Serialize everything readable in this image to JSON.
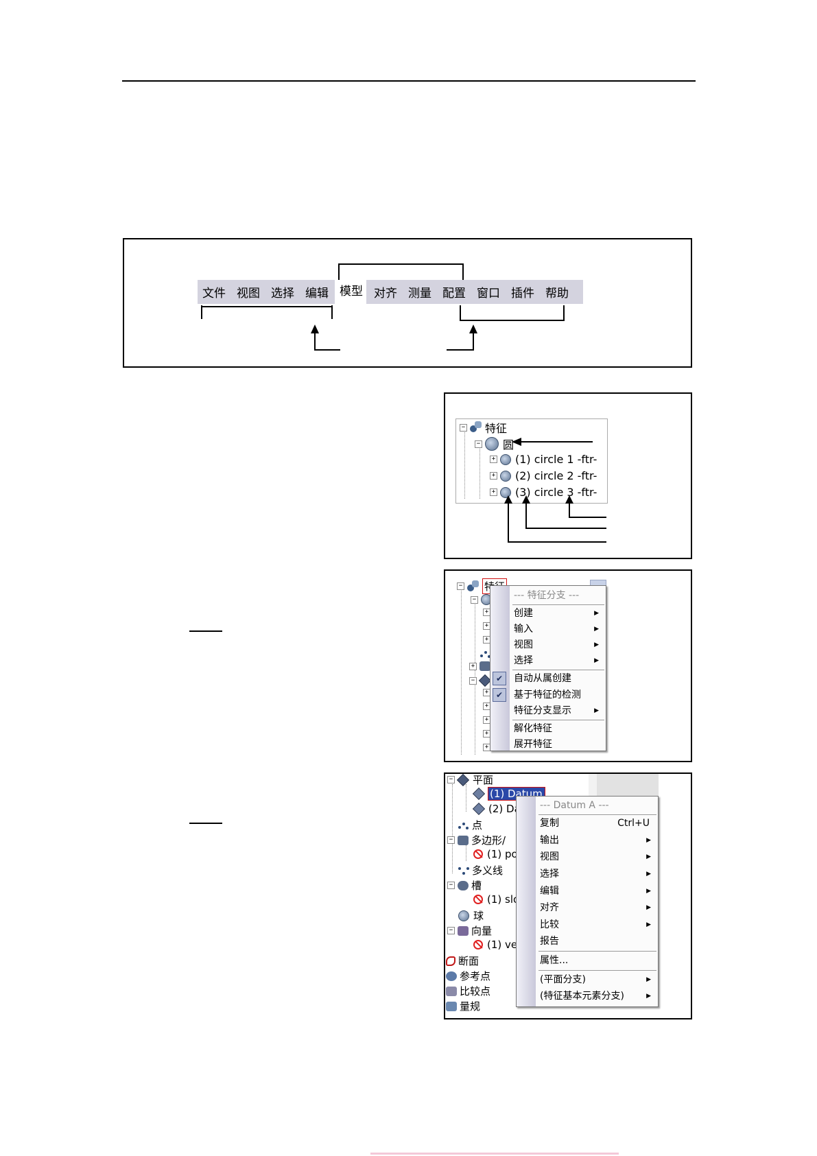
{
  "menu_bar": {
    "items": [
      "文件",
      "视图",
      "选择",
      "编辑",
      "模型",
      "对齐",
      "测量",
      "配置",
      "窗口",
      "插件",
      "帮助"
    ]
  },
  "feature_tree": {
    "root": "特征",
    "group": "圆",
    "items": [
      "(1) circle 1 -ftr-",
      "(2) circle 2 -ftr-",
      "(3) circle 3 -ftr-"
    ]
  },
  "feature_menu": {
    "tree_root": "特征",
    "items": [
      {
        "label": "--- 特征分支 ---",
        "disabled": true
      },
      {
        "label": "创建",
        "submenu": true
      },
      {
        "label": "输入",
        "submenu": true
      },
      {
        "label": "视图",
        "submenu": true
      },
      {
        "label": "选择",
        "submenu": true
      },
      {
        "label": "自动从属创建",
        "checked": true
      },
      {
        "label": "基于特征的检测",
        "checked": true
      },
      {
        "label": "特征分支显示",
        "submenu": true
      },
      {
        "label": "解化特征"
      },
      {
        "label": "展开特征"
      }
    ]
  },
  "datum_tree": {
    "items": [
      "平面",
      "(1) Datum A",
      "(2) Da",
      "点",
      "多边形/",
      "(1) po",
      "多义线",
      "槽",
      "(1) slo",
      "球",
      "向量",
      "(1) ve",
      "断面",
      "参考点",
      "比较点",
      "量规"
    ]
  },
  "datum_menu": {
    "items": [
      {
        "label": "--- Datum A ---",
        "disabled": true
      },
      {
        "label": "复制",
        "shortcut": "Ctrl+U"
      },
      {
        "label": "输出",
        "submenu": true
      },
      {
        "label": "视图",
        "submenu": true
      },
      {
        "label": "选择",
        "submenu": true
      },
      {
        "label": "编辑",
        "submenu": true
      },
      {
        "label": "对齐",
        "submenu": true
      },
      {
        "label": "比较",
        "submenu": true
      },
      {
        "label": "报告"
      },
      {
        "label": "属性..."
      },
      {
        "label": "(平面分支)",
        "submenu": true
      },
      {
        "label": "(特征基本元素分支)",
        "submenu": true
      }
    ]
  }
}
